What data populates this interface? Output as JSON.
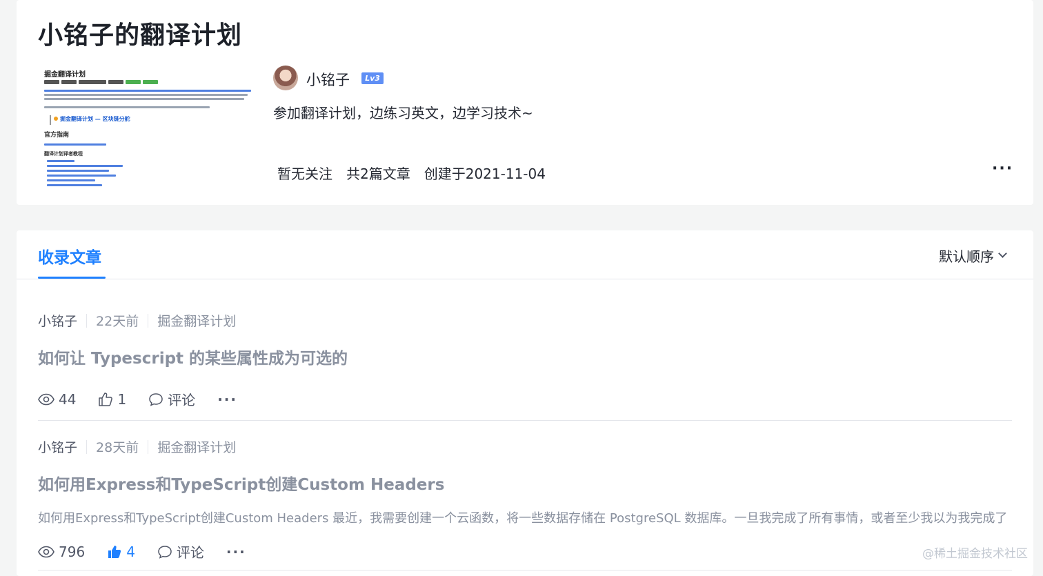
{
  "header": {
    "title": "小铭子的翻译计划",
    "cover": {
      "title": "掘金翻译计划",
      "official_guide": "官方指南",
      "link_text": "掘金翻译计划 — 区块链分舵",
      "sub": "翻译计划译者教程"
    },
    "author": {
      "name": "小铭子",
      "level": "Lv3"
    },
    "description": "参加翻译计划，边练习英文，边学习技术~",
    "stats": {
      "followers": "暂无关注",
      "articles": "共2篇文章",
      "created": "创建于2021-11-04"
    },
    "more": "···"
  },
  "articles_section": {
    "tab_label": "收录文章",
    "sort_label": "默认顺序",
    "items": [
      {
        "author": "小铭子",
        "time": "22天前",
        "tag": "掘金翻译计划",
        "title": "如何让 Typescript 的某些属性成为可选的",
        "abstract": "",
        "views": "44",
        "likes": "1",
        "liked": false,
        "comment_label": "评论",
        "more": "···"
      },
      {
        "author": "小铭子",
        "time": "28天前",
        "tag": "掘金翻译计划",
        "title": "如何用Express和TypeScript创建Custom Headers",
        "abstract": "如何用Express和TypeScript创建Custom Headers 最近，我需要创建一个云函数，将一些数据存储在 PostgreSQL 数据库。一旦我完成了所有事情，或者至少我以为我完成了",
        "views": "796",
        "likes": "4",
        "liked": true,
        "comment_label": "评论",
        "more": "···"
      }
    ]
  },
  "watermark": "@稀土掘金技术社区",
  "colors": {
    "accent": "#1e80ff",
    "text": "#252933",
    "muted": "#8a919f",
    "background": "#f4f5f5"
  }
}
